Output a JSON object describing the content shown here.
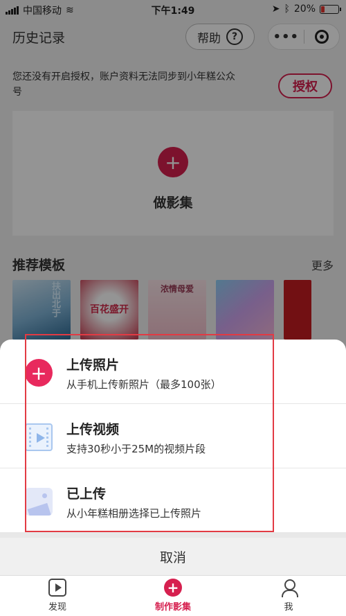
{
  "status_bar": {
    "carrier": "中国移动",
    "time": "下午1:49",
    "battery": "20%",
    "battery_level": 0.2
  },
  "nav": {
    "title": "历史记录",
    "help_label": "帮助",
    "help_icon": "?",
    "more_icon": "•••"
  },
  "auth": {
    "message": "您还没有开启授权，账户资料无法同步到小年糕公众号",
    "button_label": "授权"
  },
  "make": {
    "icon": "+",
    "label": "做影集"
  },
  "recommend": {
    "title": "推荐模板",
    "more": "更多",
    "templates": [
      {
        "text": "扶出北于"
      },
      {
        "text": "百花盛开"
      },
      {
        "text": "浓情母爱"
      },
      {
        "text": ""
      },
      {
        "text": ""
      }
    ]
  },
  "sheet": {
    "options": [
      {
        "title": "上传照片",
        "desc": "从手机上传新照片（最多100张）",
        "icon": "+"
      },
      {
        "title": "上传视频",
        "desc": "支持30秒小于25M的视频片段",
        "icon": ""
      },
      {
        "title": "已上传",
        "desc": "从小年糕相册选择已上传照片",
        "icon": ""
      }
    ],
    "cancel": "取消"
  },
  "tabbar": {
    "tabs": [
      {
        "label": "发现",
        "icon": ""
      },
      {
        "label": "制作影集",
        "icon": "+"
      },
      {
        "label": "我",
        "icon": ""
      }
    ]
  },
  "colors": {
    "brand": "#d6204f",
    "highlight": "#e23a43"
  },
  "icons": [
    "signal-icon",
    "wifi-icon",
    "battery-icon",
    "help-icon",
    "more-dots-icon",
    "record-icon",
    "plus-icon",
    "video-icon",
    "image-icon",
    "play-icon",
    "user-icon"
  ]
}
